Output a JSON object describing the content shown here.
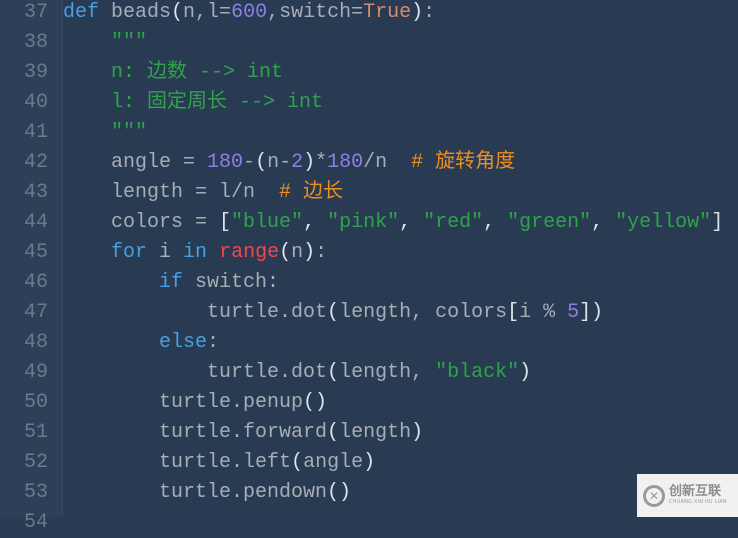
{
  "editor": {
    "language": "python",
    "lines": [
      {
        "number": "37",
        "indent_guides": 0,
        "tokens": [
          {
            "t": "def",
            "c": "kw"
          },
          {
            "t": " beads",
            "c": ""
          },
          {
            "t": "(",
            "c": "punc"
          },
          {
            "t": "n,l=",
            "c": ""
          },
          {
            "t": "600",
            "c": "num"
          },
          {
            "t": ",switch=",
            "c": ""
          },
          {
            "t": "True",
            "c": "bool"
          },
          {
            "t": ")",
            "c": "punc"
          },
          {
            "t": ":",
            "c": ""
          }
        ]
      },
      {
        "number": "38",
        "indent_guides": 0,
        "tokens": [
          {
            "t": "    \"\"\"",
            "c": "doc"
          }
        ]
      },
      {
        "number": "39",
        "indent_guides": 0,
        "tokens": [
          {
            "t": "    n: 边数 --> int",
            "c": "doc"
          }
        ]
      },
      {
        "number": "40",
        "indent_guides": 0,
        "tokens": [
          {
            "t": "    l: 固定周长 --> int",
            "c": "doc"
          }
        ]
      },
      {
        "number": "41",
        "indent_guides": 0,
        "tokens": [
          {
            "t": "    \"\"\"",
            "c": "doc"
          }
        ]
      },
      {
        "number": "42",
        "indent_guides": 0,
        "tokens": [
          {
            "t": "    angle = ",
            "c": ""
          },
          {
            "t": "180",
            "c": "num"
          },
          {
            "t": "-",
            "c": ""
          },
          {
            "t": "(",
            "c": "punc"
          },
          {
            "t": "n-",
            "c": ""
          },
          {
            "t": "2",
            "c": "num"
          },
          {
            "t": ")",
            "c": "punc"
          },
          {
            "t": "*",
            "c": ""
          },
          {
            "t": "180",
            "c": "num"
          },
          {
            "t": "/n  ",
            "c": ""
          },
          {
            "t": "# 旋转角度",
            "c": "cmt"
          }
        ]
      },
      {
        "number": "43",
        "indent_guides": 0,
        "tokens": [
          {
            "t": "    length = l/n  ",
            "c": ""
          },
          {
            "t": "# 边长",
            "c": "cmt"
          }
        ]
      },
      {
        "number": "44",
        "indent_guides": 0,
        "tokens": [
          {
            "t": "    colors = ",
            "c": ""
          },
          {
            "t": "[",
            "c": "punc"
          },
          {
            "t": "\"blue\"",
            "c": "str"
          },
          {
            "t": ", ",
            "c": "punc"
          },
          {
            "t": "\"pink\"",
            "c": "str"
          },
          {
            "t": ", ",
            "c": "punc"
          },
          {
            "t": "\"red\"",
            "c": "str"
          },
          {
            "t": ", ",
            "c": "punc"
          },
          {
            "t": "\"green\"",
            "c": "str"
          },
          {
            "t": ", ",
            "c": "punc"
          },
          {
            "t": "\"yellow\"",
            "c": "str"
          },
          {
            "t": "]",
            "c": "punc"
          }
        ]
      },
      {
        "number": "45",
        "indent_guides": 0,
        "tokens": [
          {
            "t": "    ",
            "c": ""
          },
          {
            "t": "for",
            "c": "kw"
          },
          {
            "t": " i ",
            "c": ""
          },
          {
            "t": "in",
            "c": "kw"
          },
          {
            "t": " ",
            "c": ""
          },
          {
            "t": "range",
            "c": "fn-red"
          },
          {
            "t": "(",
            "c": "punc"
          },
          {
            "t": "n",
            "c": ""
          },
          {
            "t": ")",
            "c": "punc"
          },
          {
            "t": ":",
            "c": ""
          }
        ]
      },
      {
        "number": "46",
        "indent_guides": 1,
        "tokens": [
          {
            "t": "        ",
            "c": ""
          },
          {
            "t": "if",
            "c": "kw"
          },
          {
            "t": " switch:",
            "c": ""
          }
        ]
      },
      {
        "number": "47",
        "indent_guides": 2,
        "tokens": [
          {
            "t": "            turtle.dot",
            "c": ""
          },
          {
            "t": "(",
            "c": "punc"
          },
          {
            "t": "length, colors",
            "c": ""
          },
          {
            "t": "[",
            "c": "punc"
          },
          {
            "t": "i % ",
            "c": ""
          },
          {
            "t": "5",
            "c": "num"
          },
          {
            "t": "]",
            "c": "punc"
          },
          {
            "t": ")",
            "c": "punc"
          }
        ]
      },
      {
        "number": "48",
        "indent_guides": 1,
        "tokens": [
          {
            "t": "        ",
            "c": ""
          },
          {
            "t": "else",
            "c": "kw"
          },
          {
            "t": ":",
            "c": ""
          }
        ]
      },
      {
        "number": "49",
        "indent_guides": 2,
        "tokens": [
          {
            "t": "            turtle.dot",
            "c": ""
          },
          {
            "t": "(",
            "c": "punc"
          },
          {
            "t": "length, ",
            "c": ""
          },
          {
            "t": "\"black\"",
            "c": "str"
          },
          {
            "t": ")",
            "c": "punc"
          }
        ]
      },
      {
        "number": "50",
        "indent_guides": 1,
        "tokens": [
          {
            "t": "        turtle.penup",
            "c": ""
          },
          {
            "t": "()",
            "c": "punc"
          }
        ]
      },
      {
        "number": "51",
        "indent_guides": 1,
        "tokens": [
          {
            "t": "        turtle.forward",
            "c": ""
          },
          {
            "t": "(",
            "c": "punc"
          },
          {
            "t": "length",
            "c": ""
          },
          {
            "t": ")",
            "c": "punc"
          }
        ]
      },
      {
        "number": "52",
        "indent_guides": 1,
        "tokens": [
          {
            "t": "        turtle.left",
            "c": ""
          },
          {
            "t": "(",
            "c": "punc"
          },
          {
            "t": "angle",
            "c": ""
          },
          {
            "t": ")",
            "c": "punc"
          }
        ]
      },
      {
        "number": "53",
        "indent_guides": 1,
        "tokens": [
          {
            "t": "        turtle.pendown",
            "c": ""
          },
          {
            "t": "()",
            "c": "punc"
          }
        ]
      },
      {
        "number": "54",
        "indent_guides": 1,
        "tokens": []
      }
    ]
  },
  "colors": {
    "background": "#283b52",
    "gutter": "#2e4058",
    "line_number": "#6b7a8c",
    "keyword": "#4a9fe0",
    "builtin": "#f0474f",
    "number": "#8d7fe3",
    "boolean": "#d98a6b",
    "string": "#2fa34c",
    "comment": "#ee8e1f",
    "identifier": "#a7adb5"
  },
  "watermark": {
    "logo_icon": "cx-circle-logo",
    "logo_glyph": "✕",
    "title": "创新互联",
    "subtitle": "CHUANG XIN HU LIAN"
  }
}
